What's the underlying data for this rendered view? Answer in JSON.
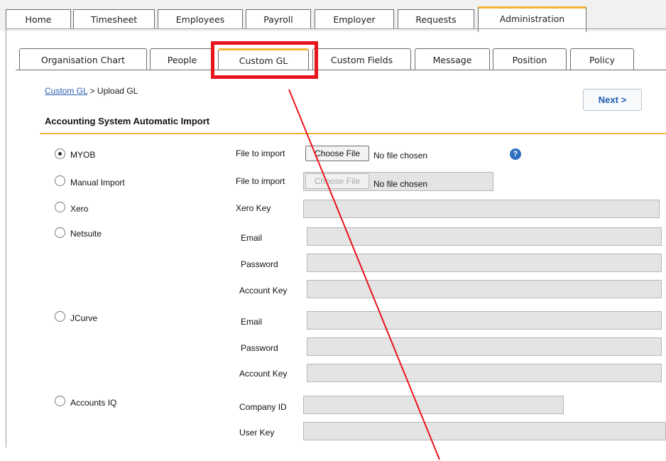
{
  "top_tabs": [
    "Home",
    "Timesheet",
    "Employees",
    "Payroll",
    "Employer",
    "Requests",
    "Administration"
  ],
  "sub_tabs": [
    "Organisation Chart",
    "People",
    "Custom GL",
    "Custom Fields",
    "Message",
    "Position",
    "Policy"
  ],
  "breadcrumb": {
    "link": "Custom GL",
    "rest": " > Upload GL"
  },
  "next_label": "Next >",
  "section_title": "Accounting System Automatic Import",
  "help_glyph": "?",
  "options": {
    "myob": {
      "label": "MYOB",
      "selected": true
    },
    "manual": {
      "label": "Manual Import",
      "selected": false
    },
    "xero": {
      "label": "Xero",
      "selected": false
    },
    "netsuite": {
      "label": "Netsuite",
      "selected": false
    },
    "jcurve": {
      "label": "JCurve",
      "selected": false
    },
    "accountsiq": {
      "label": "Accounts IQ",
      "selected": false
    }
  },
  "fields": {
    "file_to_import": "File to import",
    "choose_file": "Choose File",
    "no_file": "No file chosen",
    "xero_key": "Xero Key",
    "email": "Email",
    "password": "Password",
    "account_key": "Account Key",
    "company_id": "Company ID",
    "user_key": "User Key"
  },
  "colors": {
    "accent": "#f2b233",
    "highlight": "#e8141d",
    "link": "#2a5db0"
  }
}
